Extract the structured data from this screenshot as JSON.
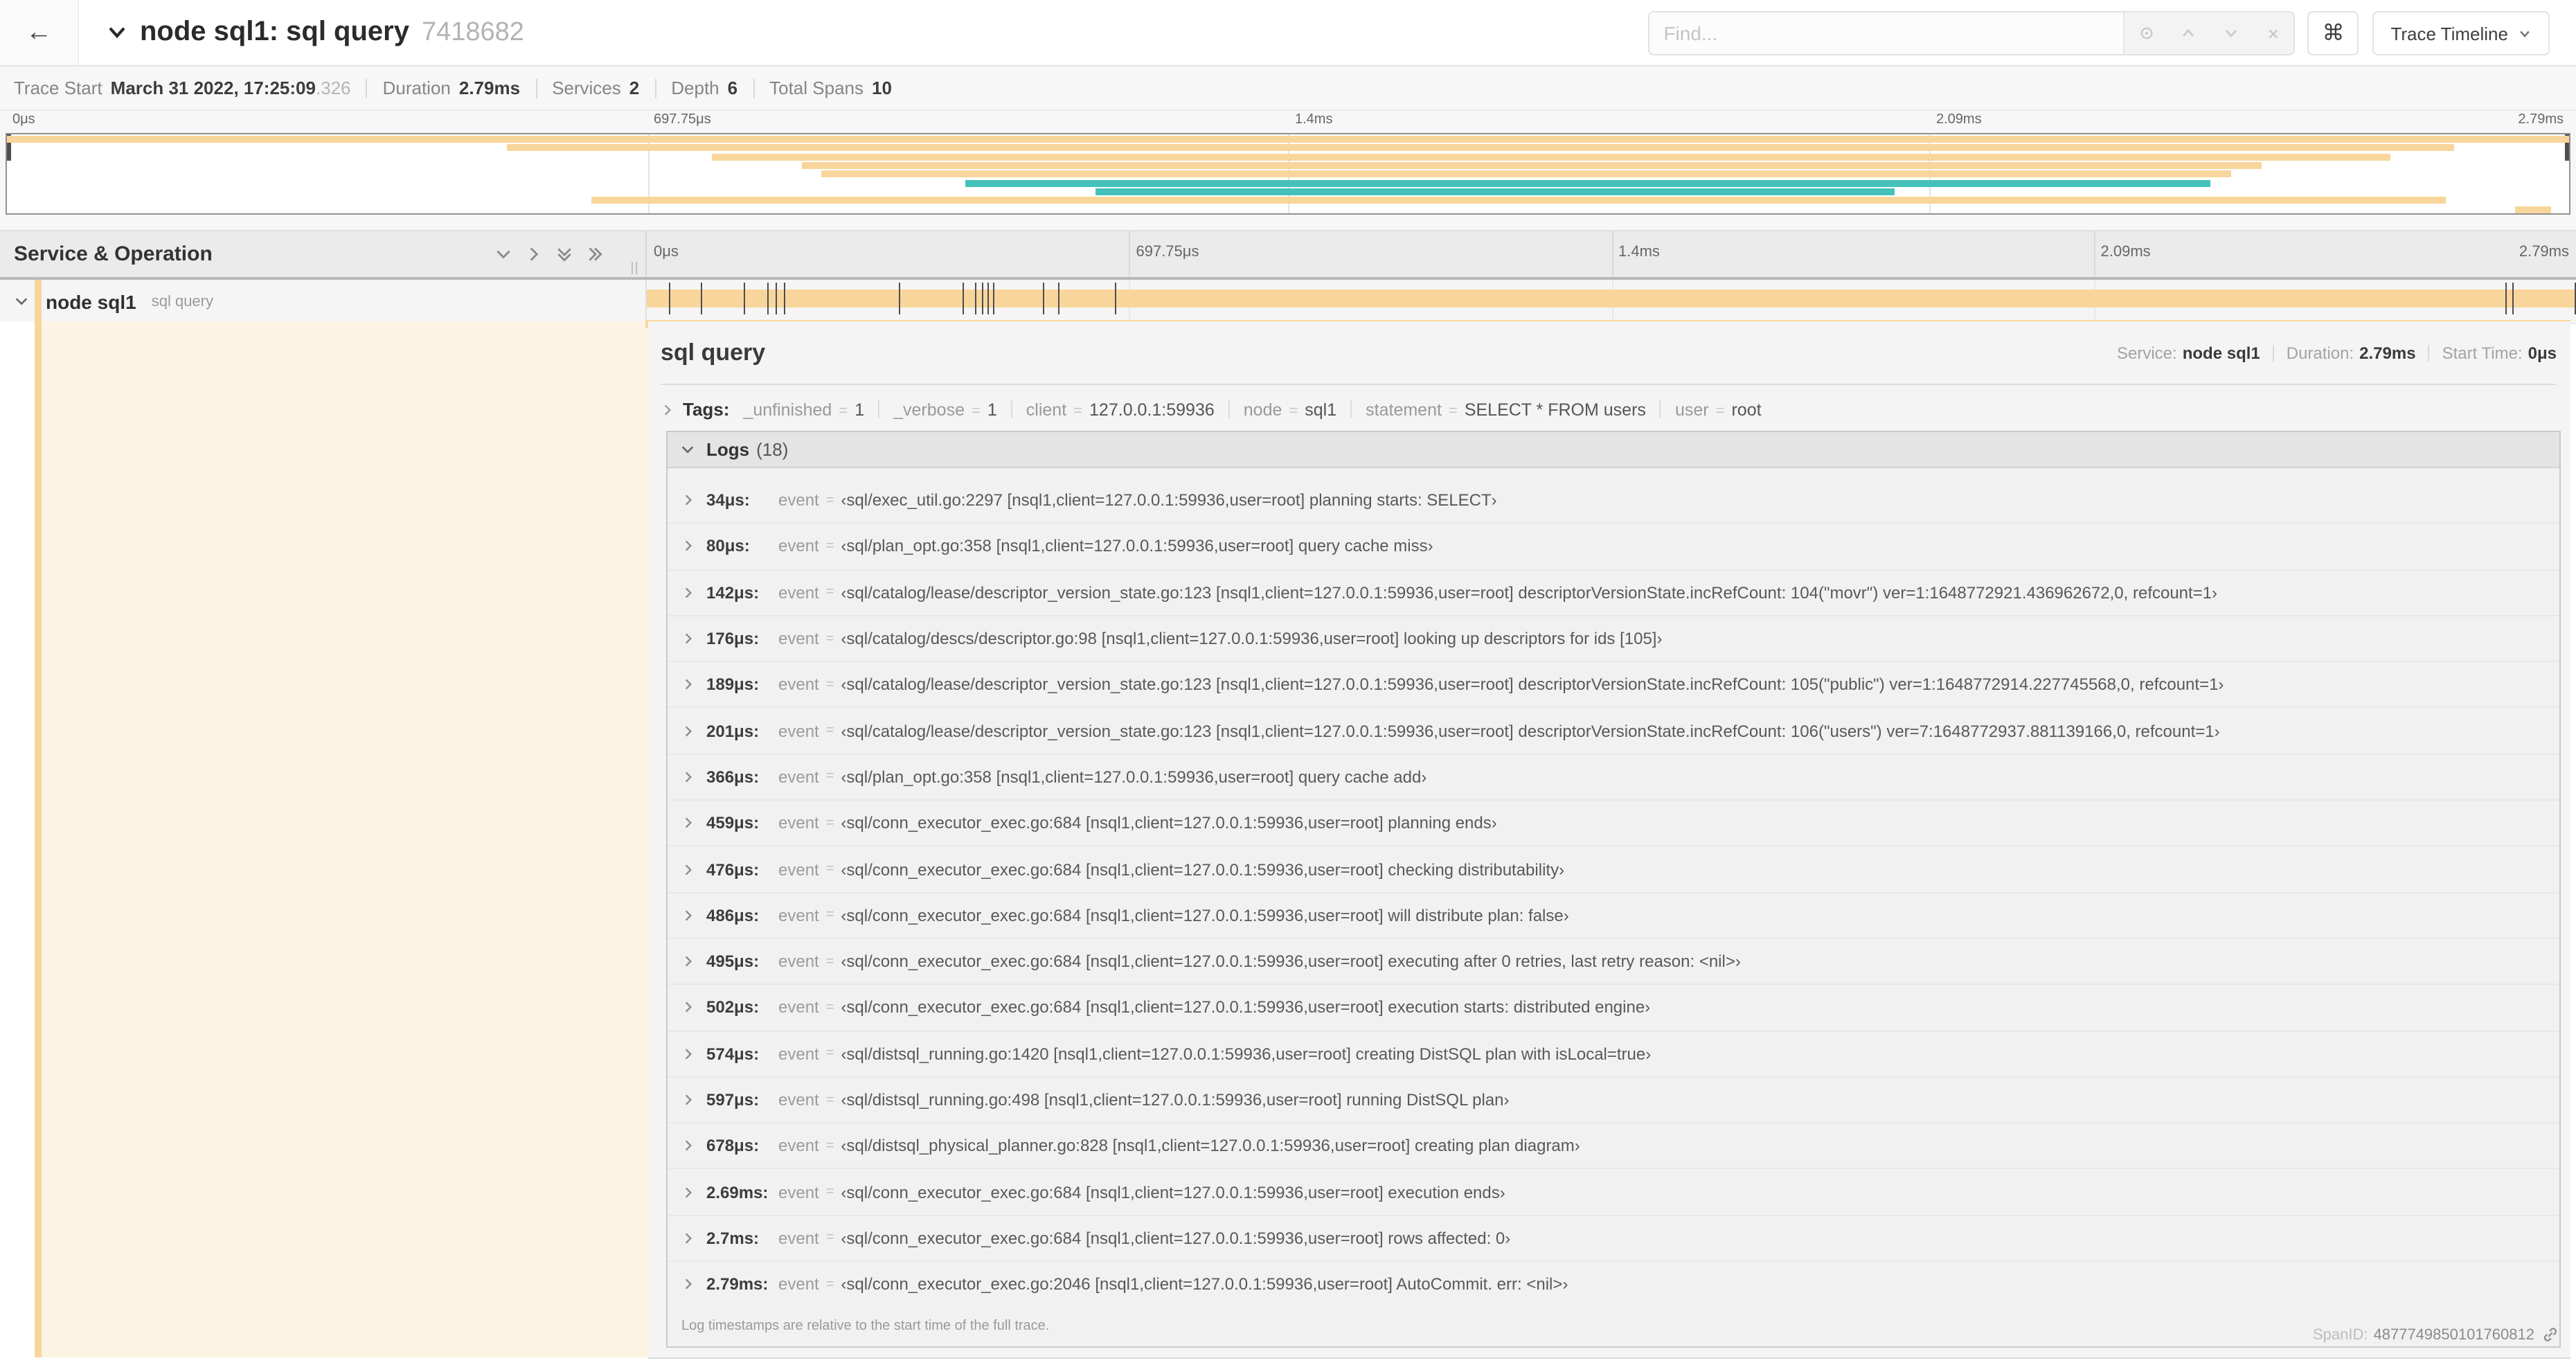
{
  "colors": {
    "span_tan": "#f8d69b",
    "teal": "#43c1ba",
    "cream": "#fcf3e3"
  },
  "nav": {
    "back_icon": "←",
    "title": "node sql1: sql query",
    "trace_id": "7418682",
    "find_placeholder": "Find...",
    "command_symbol": "⌘",
    "view_button_label": "Trace Timeline"
  },
  "summary": {
    "items": [
      {
        "label": "Trace Start",
        "value": "March 31 2022, 17:25:09",
        "suffix": ".326"
      },
      {
        "label": "Duration",
        "value": "2.79ms",
        "suffix": ""
      },
      {
        "label": "Services",
        "value": "2",
        "suffix": ""
      },
      {
        "label": "Depth",
        "value": "6",
        "suffix": ""
      },
      {
        "label": "Total Spans",
        "value": "10",
        "suffix": ""
      }
    ]
  },
  "minimap": {
    "axis_labels": [
      "0μs",
      "697.75μs",
      "1.4ms",
      "2.09ms",
      "2.79ms"
    ],
    "bars": [
      {
        "row": 0,
        "start": 0,
        "end": 100,
        "color": "tan"
      },
      {
        "row": 1,
        "start": 19.5,
        "end": 95.5,
        "color": "tan"
      },
      {
        "row": 2,
        "start": 27.5,
        "end": 93,
        "color": "tan"
      },
      {
        "row": 3,
        "start": 31,
        "end": 88,
        "color": "tan"
      },
      {
        "row": 4,
        "start": 31.8,
        "end": 86.8,
        "color": "tan"
      },
      {
        "row": 5,
        "start": 37.4,
        "end": 86,
        "color": "teal"
      },
      {
        "row": 6,
        "start": 42.5,
        "end": 73.7,
        "color": "teal"
      },
      {
        "row": 7,
        "start": 22.8,
        "end": 95.2,
        "color": "tan"
      },
      {
        "row": 8,
        "start": 97.9,
        "end": 99.3,
        "color": "tan"
      }
    ]
  },
  "timeline": {
    "left_header": "Service & Operation",
    "ruler_labels": [
      "0μs",
      "697.75μs",
      "1.4ms",
      "2.09ms",
      "2.79ms"
    ],
    "duration_us": 2790
  },
  "span_row": {
    "service": "node sql1",
    "operation": "sql query"
  },
  "detail": {
    "title": "sql query",
    "overview": [
      {
        "label": "Service:",
        "value": "node sql1"
      },
      {
        "label": "Duration:",
        "value": "2.79ms"
      },
      {
        "label": "Start Time:",
        "value": "0μs"
      }
    ],
    "tags_label": "Tags:",
    "tags": [
      {
        "key": "_unfinished",
        "value": "1"
      },
      {
        "key": "_verbose",
        "value": "1"
      },
      {
        "key": "client",
        "value": "127.0.0.1:59936"
      },
      {
        "key": "node",
        "value": "sql1"
      },
      {
        "key": "statement",
        "value": "SELECT * FROM users"
      },
      {
        "key": "user",
        "value": "root"
      }
    ],
    "logs_label": "Logs",
    "logs_count": "(18)",
    "event_label": "event",
    "logs": [
      {
        "time": "34μs:",
        "t_us": 34,
        "value": "‹sql/exec_util.go:2297 [nsql1,client=127.0.0.1:59936,user=root] planning starts: SELECT›"
      },
      {
        "time": "80μs:",
        "t_us": 80,
        "value": "‹sql/plan_opt.go:358 [nsql1,client=127.0.0.1:59936,user=root] query cache miss›"
      },
      {
        "time": "142μs:",
        "t_us": 142,
        "value": "‹sql/catalog/lease/descriptor_version_state.go:123 [nsql1,client=127.0.0.1:59936,user=root] descriptorVersionState.incRefCount: 104(\"movr\") ver=1:1648772921.436962672,0, refcount=1›"
      },
      {
        "time": "176μs:",
        "t_us": 176,
        "value": "‹sql/catalog/descs/descriptor.go:98 [nsql1,client=127.0.0.1:59936,user=root] looking up descriptors for ids [105]›"
      },
      {
        "time": "189μs:",
        "t_us": 189,
        "value": "‹sql/catalog/lease/descriptor_version_state.go:123 [nsql1,client=127.0.0.1:59936,user=root] descriptorVersionState.incRefCount: 105(\"public\") ver=1:1648772914.227745568,0, refcount=1›"
      },
      {
        "time": "201μs:",
        "t_us": 201,
        "value": "‹sql/catalog/lease/descriptor_version_state.go:123 [nsql1,client=127.0.0.1:59936,user=root] descriptorVersionState.incRefCount: 106(\"users\") ver=7:1648772937.881139166,0, refcount=1›"
      },
      {
        "time": "366μs:",
        "t_us": 366,
        "value": "‹sql/plan_opt.go:358 [nsql1,client=127.0.0.1:59936,user=root] query cache add›"
      },
      {
        "time": "459μs:",
        "t_us": 459,
        "value": "‹sql/conn_executor_exec.go:684 [nsql1,client=127.0.0.1:59936,user=root] planning ends›"
      },
      {
        "time": "476μs:",
        "t_us": 476,
        "value": "‹sql/conn_executor_exec.go:684 [nsql1,client=127.0.0.1:59936,user=root] checking distributability›"
      },
      {
        "time": "486μs:",
        "t_us": 486,
        "value": "‹sql/conn_executor_exec.go:684 [nsql1,client=127.0.0.1:59936,user=root] will distribute plan: false›"
      },
      {
        "time": "495μs:",
        "t_us": 495,
        "value": "‹sql/conn_executor_exec.go:684 [nsql1,client=127.0.0.1:59936,user=root] executing after 0 retries, last retry reason: <nil>›"
      },
      {
        "time": "502μs:",
        "t_us": 502,
        "value": "‹sql/conn_executor_exec.go:684 [nsql1,client=127.0.0.1:59936,user=root] execution starts: distributed engine›"
      },
      {
        "time": "574μs:",
        "t_us": 574,
        "value": "‹sql/distsql_running.go:1420 [nsql1,client=127.0.0.1:59936,user=root] creating DistSQL plan with isLocal=true›"
      },
      {
        "time": "597μs:",
        "t_us": 597,
        "value": "‹sql/distsql_running.go:498 [nsql1,client=127.0.0.1:59936,user=root] running DistSQL plan›"
      },
      {
        "time": "678μs:",
        "t_us": 678,
        "value": "‹sql/distsql_physical_planner.go:828 [nsql1,client=127.0.0.1:59936,user=root] creating plan diagram›"
      },
      {
        "time": "2.69ms:",
        "t_us": 2690,
        "value": "‹sql/conn_executor_exec.go:684 [nsql1,client=127.0.0.1:59936,user=root] execution ends›"
      },
      {
        "time": "2.7ms:",
        "t_us": 2700,
        "value": "‹sql/conn_executor_exec.go:684 [nsql1,client=127.0.0.1:59936,user=root] rows affected: 0›"
      },
      {
        "time": "2.79ms:",
        "t_us": 2790,
        "value": "‹sql/conn_executor_exec.go:2046 [nsql1,client=127.0.0.1:59936,user=root] AutoCommit. err: <nil>›"
      }
    ],
    "logs_note": "Log timestamps are relative to the start time of the full trace.",
    "spanid_label": "SpanID:",
    "spanid": "4877749850101760812"
  }
}
